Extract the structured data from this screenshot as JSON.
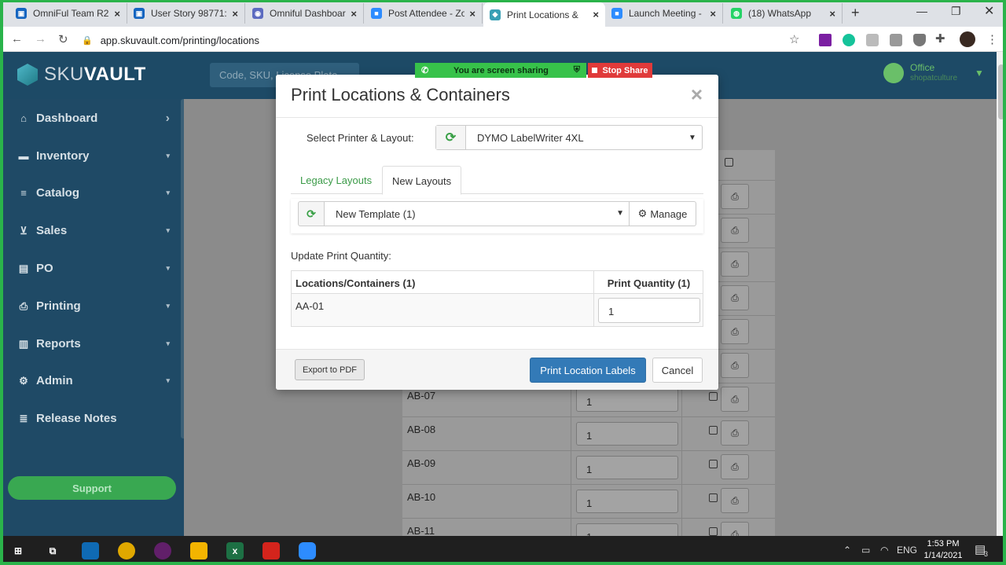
{
  "browser": {
    "tabs": [
      {
        "title": "OmniFul Team R2",
        "color": "#1565c0",
        "glyph": "▣"
      },
      {
        "title": "User Story 98771:",
        "color": "#1565c0",
        "glyph": "▣"
      },
      {
        "title": "Omniful Dashboar",
        "color": "#5c6bc0",
        "glyph": "◉"
      },
      {
        "title": "Post Attendee - Zo",
        "color": "#2d8cff",
        "glyph": "■"
      },
      {
        "title": "Print Locations &",
        "color": "#39a0b5",
        "glyph": "◆"
      },
      {
        "title": "Launch Meeting -",
        "color": "#2d8cff",
        "glyph": "■"
      },
      {
        "title": "(18) WhatsApp",
        "color": "#25d366",
        "glyph": "◍"
      }
    ],
    "url": "app.skuvault.com/printing/locations"
  },
  "header": {
    "logo_light": "SKU",
    "logo_bold": "VAULT",
    "search_placeholder": "Code, SKU, License Plate",
    "user_name": "Office",
    "user_sub": "shopatculture"
  },
  "share": {
    "sharing_label": "You are screen sharing",
    "stop_label": "Stop Share"
  },
  "sidebar": {
    "items": [
      {
        "label": "Dashboard",
        "icon": "home-icon",
        "glyph": "⌂",
        "caret": "›"
      },
      {
        "label": "Inventory",
        "icon": "briefcase-icon",
        "glyph": "▬",
        "caret": "▾"
      },
      {
        "label": "Catalog",
        "icon": "list-icon",
        "glyph": "≡",
        "caret": "▾"
      },
      {
        "label": "Sales",
        "icon": "cart-icon",
        "glyph": "⊻",
        "caret": "▾"
      },
      {
        "label": "PO",
        "icon": "file-icon",
        "glyph": "▤",
        "caret": "▾"
      },
      {
        "label": "Printing",
        "icon": "printer-icon",
        "glyph": "⎙",
        "caret": "▾"
      },
      {
        "label": "Reports",
        "icon": "bar-chart-icon",
        "glyph": "▥",
        "caret": "▾"
      },
      {
        "label": "Admin",
        "icon": "cogs-icon",
        "glyph": "⚙",
        "caret": "▾"
      },
      {
        "label": "Release Notes",
        "icon": "list-icon",
        "glyph": "≣",
        "caret": ""
      }
    ],
    "support_label": "Support"
  },
  "background_rows": [
    {
      "loc": "AB-07",
      "qty": "1"
    },
    {
      "loc": "AB-08",
      "qty": "1"
    },
    {
      "loc": "AB-09",
      "qty": "1"
    },
    {
      "loc": "AB-10",
      "qty": "1"
    },
    {
      "loc": "AB-11",
      "qty": "1"
    }
  ],
  "modal": {
    "title": "Print Locations & Containers",
    "close": "×",
    "printer_label": "Select Printer & Layout:",
    "printer_value": "DYMO LabelWriter 4XL",
    "tab_legacy": "Legacy Layouts",
    "tab_new": "New Layouts",
    "template_value": "New Template (1)",
    "manage_label": "Manage",
    "update_qty_label": "Update Print Quantity:",
    "col_locations": "Locations/Containers (1)",
    "col_quantity": "Print Quantity (1)",
    "rows": [
      {
        "location": "AA-01",
        "quantity": "1"
      }
    ],
    "export_label": "Export to PDF",
    "print_label": "Print Location Labels",
    "cancel_label": "Cancel"
  },
  "taskbar": {
    "time": "1:53 PM",
    "date": "1/14/2021",
    "lang": "ENG",
    "notif_count": "3"
  },
  "colors": {
    "header_bg": "#1d4a66",
    "primary_button": "#337ab7",
    "accent_green": "#3a9a47"
  }
}
